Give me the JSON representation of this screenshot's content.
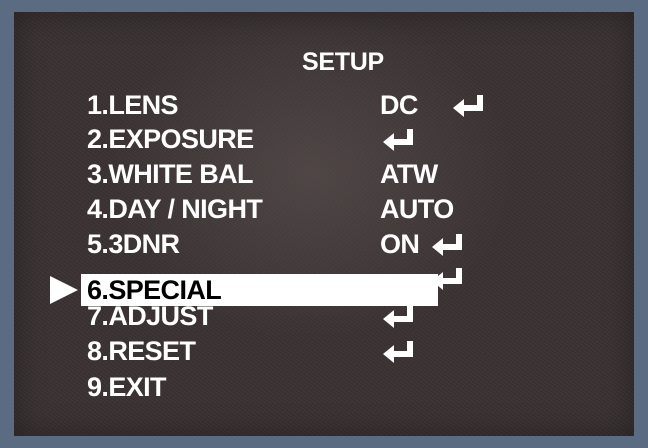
{
  "menu": {
    "title": "SETUP",
    "items": [
      {
        "label": "1.LENS",
        "value": "DC",
        "enter": true
      },
      {
        "label": "2.EXPOSURE",
        "value": "",
        "enter": true
      },
      {
        "label": "3.WHITE BAL",
        "value": "ATW",
        "enter": false
      },
      {
        "label": "4.DAY / NIGHT",
        "value": "AUTO",
        "enter": false
      },
      {
        "label": "5.3DNR",
        "value": "ON",
        "enter": true
      },
      {
        "label": "6.SPECIAL",
        "value": "",
        "enter": true,
        "selected": true
      },
      {
        "label": "7.ADJUST",
        "value": "",
        "enter": true
      },
      {
        "label": "8.RESET",
        "value": "",
        "enter": true
      },
      {
        "label": "9.EXIT",
        "value": "",
        "enter": false
      }
    ]
  },
  "icons": {
    "cursor": "right-triangle-cursor",
    "enter": "enter-return-arrow"
  },
  "colors": {
    "text": "#ffffff",
    "highlight": "#ffffff",
    "highlight_text": "#000000",
    "frame": "#5a6b82"
  }
}
